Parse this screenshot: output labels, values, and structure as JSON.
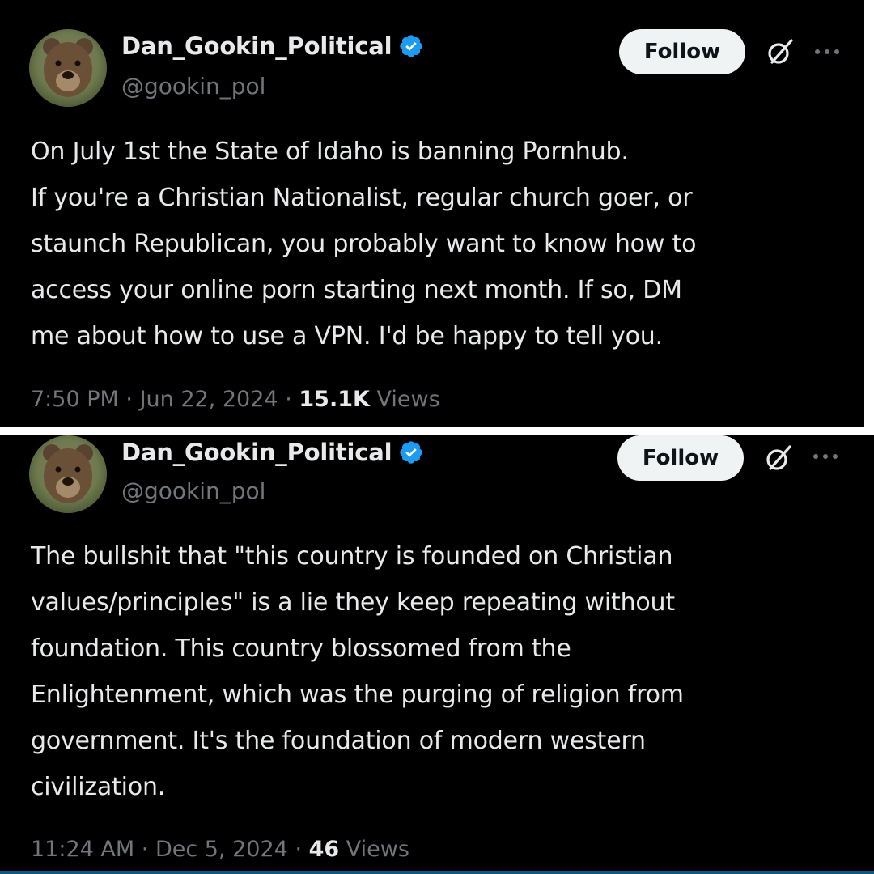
{
  "colors": {
    "background": "#000000",
    "text_primary": "#e7e9ea",
    "text_secondary": "#71767b",
    "verified_badge": "#1d9bf0",
    "follow_button_bg": "#eff3f4",
    "follow_button_text": "#0f1419"
  },
  "posts": [
    {
      "author": {
        "display_name": "Dan_Gookin_Political",
        "handle": "@gookin_pol",
        "verified": true,
        "avatar_icon": "bear-avatar"
      },
      "follow_label": "Follow",
      "action_icons": [
        "grok-icon",
        "more-options-icon"
      ],
      "text": "On July 1st the State of Idaho is banning Pornhub.\nIf you're a Christian Nationalist, regular church goer, or\nstaunch Republican, you probably want to know how to\naccess your online porn starting next month. If so, DM\nme about how to use a VPN. I'd be happy to tell you.",
      "time": "7:50 PM",
      "date": "Jun 22, 2024",
      "separator": "·",
      "views_count": "15.1K",
      "views_label": "Views"
    },
    {
      "author": {
        "display_name": "Dan_Gookin_Political",
        "handle": "@gookin_pol",
        "verified": true,
        "avatar_icon": "bear-avatar"
      },
      "follow_label": "Follow",
      "action_icons": [
        "grok-icon",
        "more-options-icon"
      ],
      "text": "The bullshit that \"this country is founded on Christian\nvalues/principles\" is a lie they keep repeating without\nfoundation. This country blossomed from the\nEnlightenment, which was the purging of religion from\ngovernment. It's the foundation of modern western\ncivilization.",
      "time": "11:24 AM",
      "date": "Dec 5, 2024",
      "separator": "·",
      "views_count": "46",
      "views_label": "Views"
    }
  ]
}
